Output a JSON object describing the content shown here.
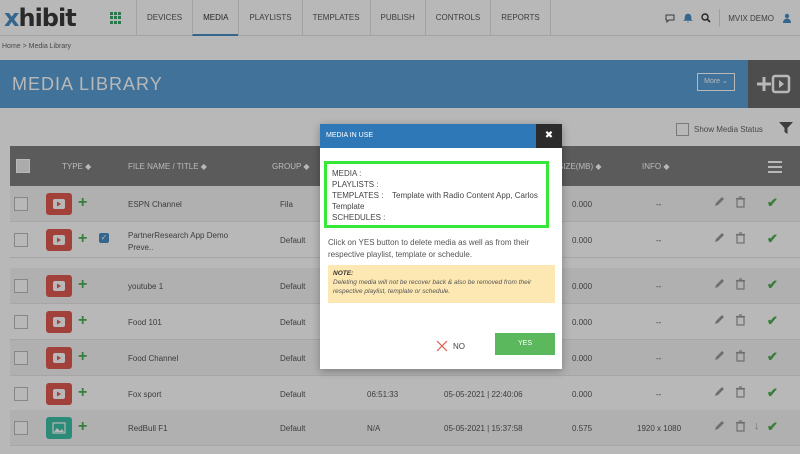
{
  "brand": {
    "logo_x": "x",
    "logo_rest": "hibit"
  },
  "nav": {
    "items": [
      "DEVICES",
      "MEDIA",
      "PLAYLISTS",
      "TEMPLATES",
      "PUBLISH",
      "CONTROLS",
      "REPORTS"
    ],
    "active": "MEDIA",
    "user": "MVIX DEMO"
  },
  "breadcrumb": "Home  >  Media Library",
  "banner": {
    "title": "MEDIA LIBRARY",
    "more": "More ⌄"
  },
  "show_status_label": "Show Media Status",
  "table": {
    "headers": {
      "type": "TYPE ◆",
      "file": "FILE NAME / TITLE ◆",
      "group": "GROUP ◆",
      "size": "SIZE(MB) ◆",
      "info": "INFO ◆"
    },
    "rows": [
      {
        "title": "ESPN Channel",
        "group": "Fila",
        "size": "0.000",
        "info": "--",
        "kind": "youtube",
        "extra": ""
      },
      {
        "title": "PartnerResearch App Demo Preve..",
        "group": "Default",
        "size": "0.000",
        "info": "--",
        "kind": "youtube",
        "extra": "check"
      },
      {
        "title": "youtube 1",
        "group": "Default",
        "size": "0.000",
        "info": "--",
        "kind": "youtube",
        "extra": ""
      },
      {
        "title": "Food 101",
        "group": "Default",
        "size": "0.000",
        "info": "--",
        "kind": "youtube",
        "extra": ""
      },
      {
        "title": "Food Channel",
        "group": "Default",
        "size": "0.000",
        "info": "--",
        "kind": "youtube",
        "extra": ""
      },
      {
        "title": "Fox sport",
        "group": "Default",
        "duration": "06:51:33",
        "date": "05-05-2021 | 22:40:06",
        "size": "0.000",
        "info": "--",
        "kind": "youtube",
        "extra": ""
      },
      {
        "title": "RedBull F1",
        "group": "Default",
        "duration": "N/A",
        "date": "05-05-2021 | 15:37:58",
        "size": "0.575",
        "info": "1920 x 1080",
        "kind": "image",
        "extra": ""
      }
    ]
  },
  "modal": {
    "title": "MEDIA IN USE",
    "close": "✖",
    "media_label": "MEDIA :",
    "playlists_label": "PLAYLISTS :",
    "templates_label": "TEMPLATES :",
    "templates_value": "Template with Radio Content App, Carlos Template",
    "schedules_label": "SCHEDULES :",
    "message": "Click on YES button to delete media as well as from their respective playlist, template or schedule.",
    "note_title": "NOTE:",
    "note_text": "Deleting media will not be recover back & also be removed from their respective playlist, template or schedule.",
    "no_label": "NO",
    "yes_label": "YES"
  },
  "colors": {
    "accent": "#5b9fd6",
    "modal_head": "#2e78b8",
    "yes": "#5cb85c",
    "highlight": "#38e838",
    "youtube": "#e05a4f",
    "image": "#3dbfa8"
  }
}
